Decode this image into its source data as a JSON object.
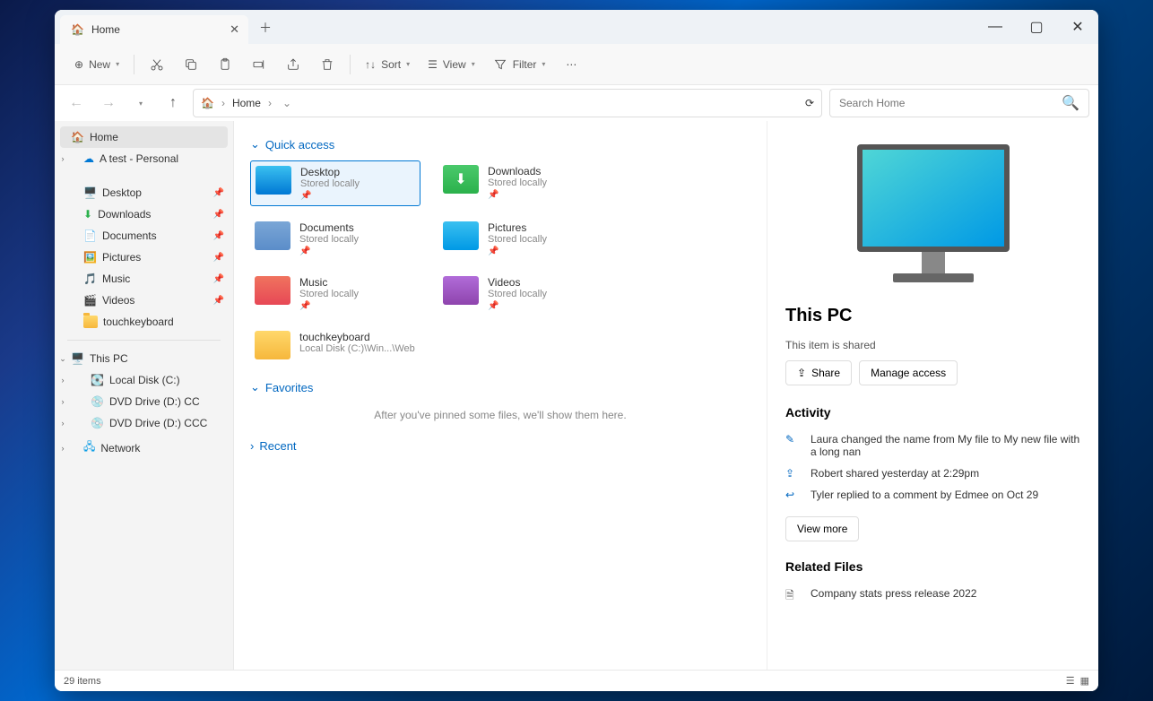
{
  "titlebar": {
    "tab_title": "Home"
  },
  "toolbar": {
    "new": "New",
    "sort": "Sort",
    "view": "View",
    "filter": "Filter"
  },
  "address": {
    "location": "Home",
    "search_placeholder": "Search Home"
  },
  "sidebar": {
    "home": "Home",
    "atest": "A test - Personal",
    "desktop": "Desktop",
    "downloads": "Downloads",
    "documents": "Documents",
    "pictures": "Pictures",
    "music": "Music",
    "videos": "Videos",
    "touchkeyboard": "touchkeyboard",
    "thispc": "This PC",
    "localdisk": "Local Disk (C:)",
    "dvd1": "DVD Drive (D:) CC",
    "dvd2": "DVD Drive (D:) CCC",
    "network": "Network"
  },
  "sections": {
    "quick_access": "Quick access",
    "favorites": "Favorites",
    "recent": "Recent",
    "fav_empty": "After you've pinned some files, we'll show them here."
  },
  "qa": {
    "desktop": {
      "name": "Desktop",
      "sub": "Stored locally"
    },
    "downloads": {
      "name": "Downloads",
      "sub": "Stored locally"
    },
    "documents": {
      "name": "Documents",
      "sub": "Stored locally"
    },
    "pictures": {
      "name": "Pictures",
      "sub": "Stored locally"
    },
    "music": {
      "name": "Music",
      "sub": "Stored locally"
    },
    "videos": {
      "name": "Videos",
      "sub": "Stored locally"
    },
    "touchkeyboard": {
      "name": "touchkeyboard",
      "sub": "Local Disk (C:)\\Win...\\Web"
    }
  },
  "details": {
    "title": "This PC",
    "shared": "This item is shared",
    "share_btn": "Share",
    "manage_btn": "Manage access",
    "activity_heading": "Activity",
    "activity": {
      "a1": "Laura changed the name from My file to My new file with a long nan",
      "a2": "Robert shared yesterday at 2:29pm",
      "a3": "Tyler replied to a comment by Edmee on Oct 29"
    },
    "view_more": "View more",
    "related_heading": "Related Files",
    "related1": "Company stats press release 2022"
  },
  "status": {
    "items": "29 items"
  }
}
